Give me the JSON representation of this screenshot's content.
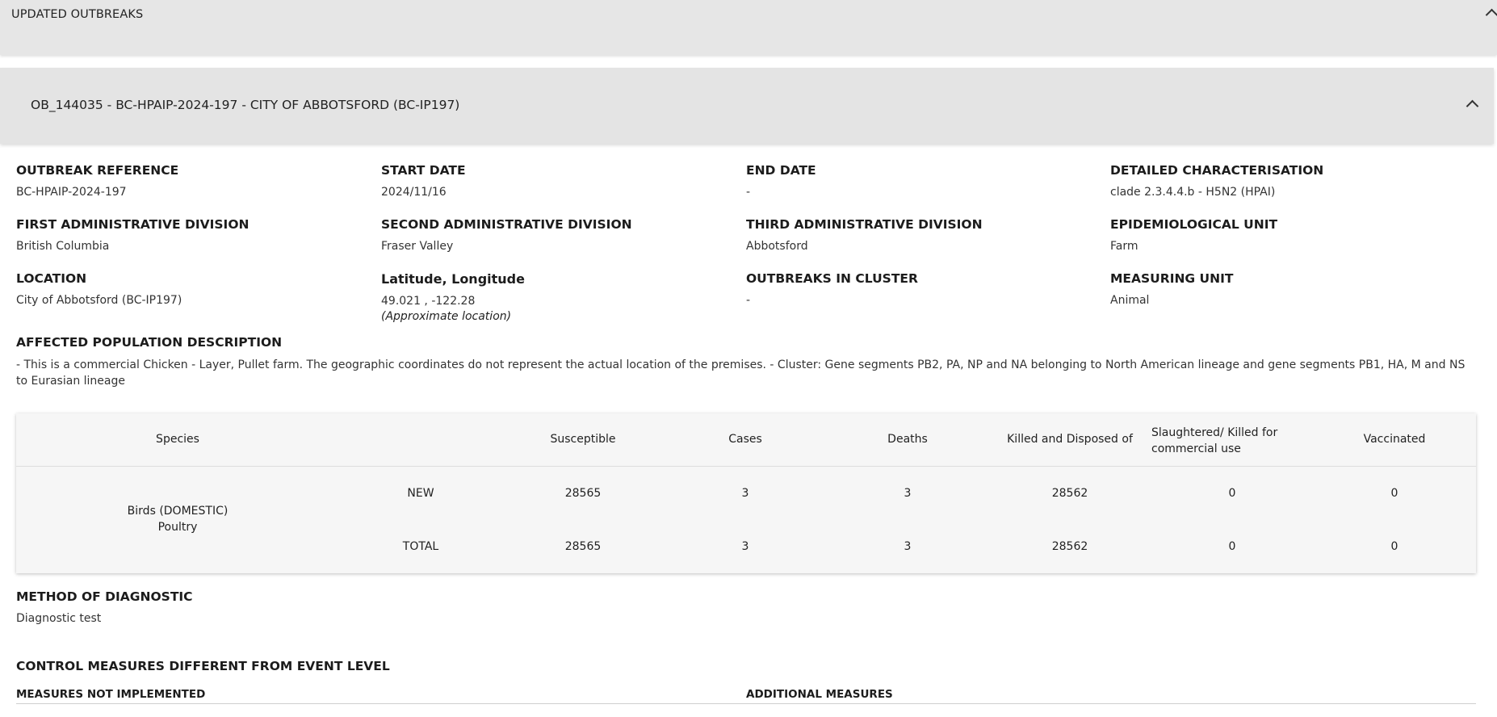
{
  "updated_outbreaks": {
    "title": "UPDATED OUTBREAKS"
  },
  "outbreak": {
    "header_title": "OB_144035 - BC-HPAIP-2024-197 - CITY OF ABBOTSFORD (BC-IP197)",
    "fields": {
      "outbreak_reference": {
        "label": "OUTBREAK REFERENCE",
        "value": "BC-HPAIP-2024-197"
      },
      "start_date": {
        "label": "START DATE",
        "value": "2024/11/16"
      },
      "end_date": {
        "label": "END DATE",
        "value": "-"
      },
      "detailed_characterisation": {
        "label": "DETAILED CHARACTERISATION",
        "value": "clade 2.3.4.4.b - H5N2 (HPAI)"
      },
      "first_admin_division": {
        "label": "FIRST ADMINISTRATIVE DIVISION",
        "value": "British Columbia"
      },
      "second_admin_division": {
        "label": "SECOND ADMINISTRATIVE DIVISION",
        "value": "Fraser Valley"
      },
      "third_admin_division": {
        "label": "THIRD ADMINISTRATIVE DIVISION",
        "value": "Abbotsford"
      },
      "epidemiological_unit": {
        "label": "EPIDEMIOLOGICAL UNIT",
        "value": "Farm"
      },
      "location": {
        "label": "LOCATION",
        "value": "City of Abbotsford (BC-IP197)"
      },
      "lat_long": {
        "label": "Latitude, Longitude",
        "value": "49.021 , -122.28",
        "note": "(Approximate location)"
      },
      "outbreaks_in_cluster": {
        "label": "OUTBREAKS IN CLUSTER",
        "value": "-"
      },
      "measuring_unit": {
        "label": "MEASURING UNIT",
        "value": "Animal"
      }
    },
    "affected_population": {
      "label": "AFFECTED POPULATION DESCRIPTION",
      "text": "- This is a commercial Chicken - Layer, Pullet farm. The geographic coordinates do not represent the actual location of the premises. - Cluster: Gene segments PB2, PA, NP and NA belonging to North American lineage and gene segments PB1, HA, M and NS to Eurasian lineage"
    },
    "species_table": {
      "headers": {
        "species": "Species",
        "susceptible": "Susceptible",
        "cases": "Cases",
        "deaths": "Deaths",
        "killed_disposed": "Killed and Disposed of",
        "slaughtered": "Slaughtered/ Killed for commercial use",
        "vaccinated": "Vaccinated"
      },
      "species_name_line1": "Birds (DOMESTIC)",
      "species_name_line2": "Poultry",
      "rows": [
        {
          "type": "NEW",
          "susceptible": "28565",
          "cases": "3",
          "deaths": "3",
          "killed_disposed": "28562",
          "slaughtered": "0",
          "vaccinated": "0"
        },
        {
          "type": "TOTAL",
          "susceptible": "28565",
          "cases": "3",
          "deaths": "3",
          "killed_disposed": "28562",
          "slaughtered": "0",
          "vaccinated": "0"
        }
      ]
    },
    "method_of_diagnostic": {
      "label": "METHOD OF DIAGNOSTIC",
      "value": "Diagnostic test"
    },
    "control_measures": {
      "label": "CONTROL MEASURES DIFFERENT FROM EVENT LEVEL",
      "not_implemented_label": "MEASURES NOT IMPLEMENTED",
      "additional_label": "ADDITIONAL MEASURES"
    }
  }
}
